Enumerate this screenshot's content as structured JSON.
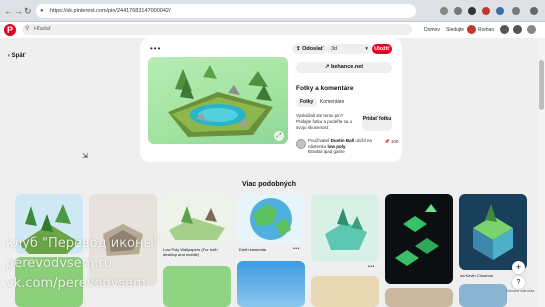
{
  "browser": {
    "url": "https://sk.pinterest.com/pin/24417683147000042/",
    "nav_back": "←",
    "nav_forward": "→",
    "nav_reload": "↻",
    "lock_icon": "🔒"
  },
  "header": {
    "logo": "P",
    "search_placeholder": "Hľadať",
    "nav_home": "Domov",
    "nav_following": "Sledujte",
    "user_name": "Roman"
  },
  "pin": {
    "back_label": "Späť",
    "more_label": "•••",
    "send_label": "Odoslať",
    "board_label": "3d",
    "save_label": "Uložiť",
    "link_label": "behance.net",
    "photos_heading": "Fotky a komentáre",
    "tab_photos": "Fotky",
    "tab_comments": "Komentáre",
    "prompt_text": "Vyskúšali ste tento pin? Pridajte fotku a podeľte sa o svoju skúsenosť.",
    "add_photo_label": "Pridať fotku",
    "saved_by_prefix": "Používateľ",
    "saved_by_user": "Dustin Ball",
    "saved_by_mid": "uložil na nástenku",
    "saved_by_board": "low poly",
    "saved_by_suffix": "Bowtail ipad game",
    "saves_count": "100"
  },
  "more_like_this": {
    "heading": "Viac podobných",
    "items": [
      {
        "caption": "",
        "color1": "#7fcf7f",
        "color2": "#cfe9f4"
      },
      {
        "caption": "",
        "color1": "#e7e3dc",
        "color2": "#d9d2c7"
      },
      {
        "caption": "Low Poly Wallpapers (For both desktop and mobile)",
        "color1": "#cfe7cf",
        "color2": "#a6cf8b"
      },
      {
        "caption": "Earth kamenitá",
        "color1": "#4fb1e0",
        "color2": "#5bc25e"
      },
      {
        "caption": "",
        "color1": "#d8f0e6",
        "color2": "#5ec7b2"
      },
      {
        "caption": "",
        "color1": "#0b0f12",
        "color2": "#35c268"
      },
      {
        "caption": "od Kevin Chouhan",
        "color1": "#1a3f5a",
        "color2": "#4cb0c8"
      }
    ]
  },
  "watermark": {
    "line1": "клуб \"Перевод иконы\"",
    "line2": "perevodvsem.ru",
    "line3": "vk.com/perevodvsem"
  },
  "floating": {
    "plus": "+",
    "help": "?",
    "hint": "Ochrana súkromia"
  }
}
